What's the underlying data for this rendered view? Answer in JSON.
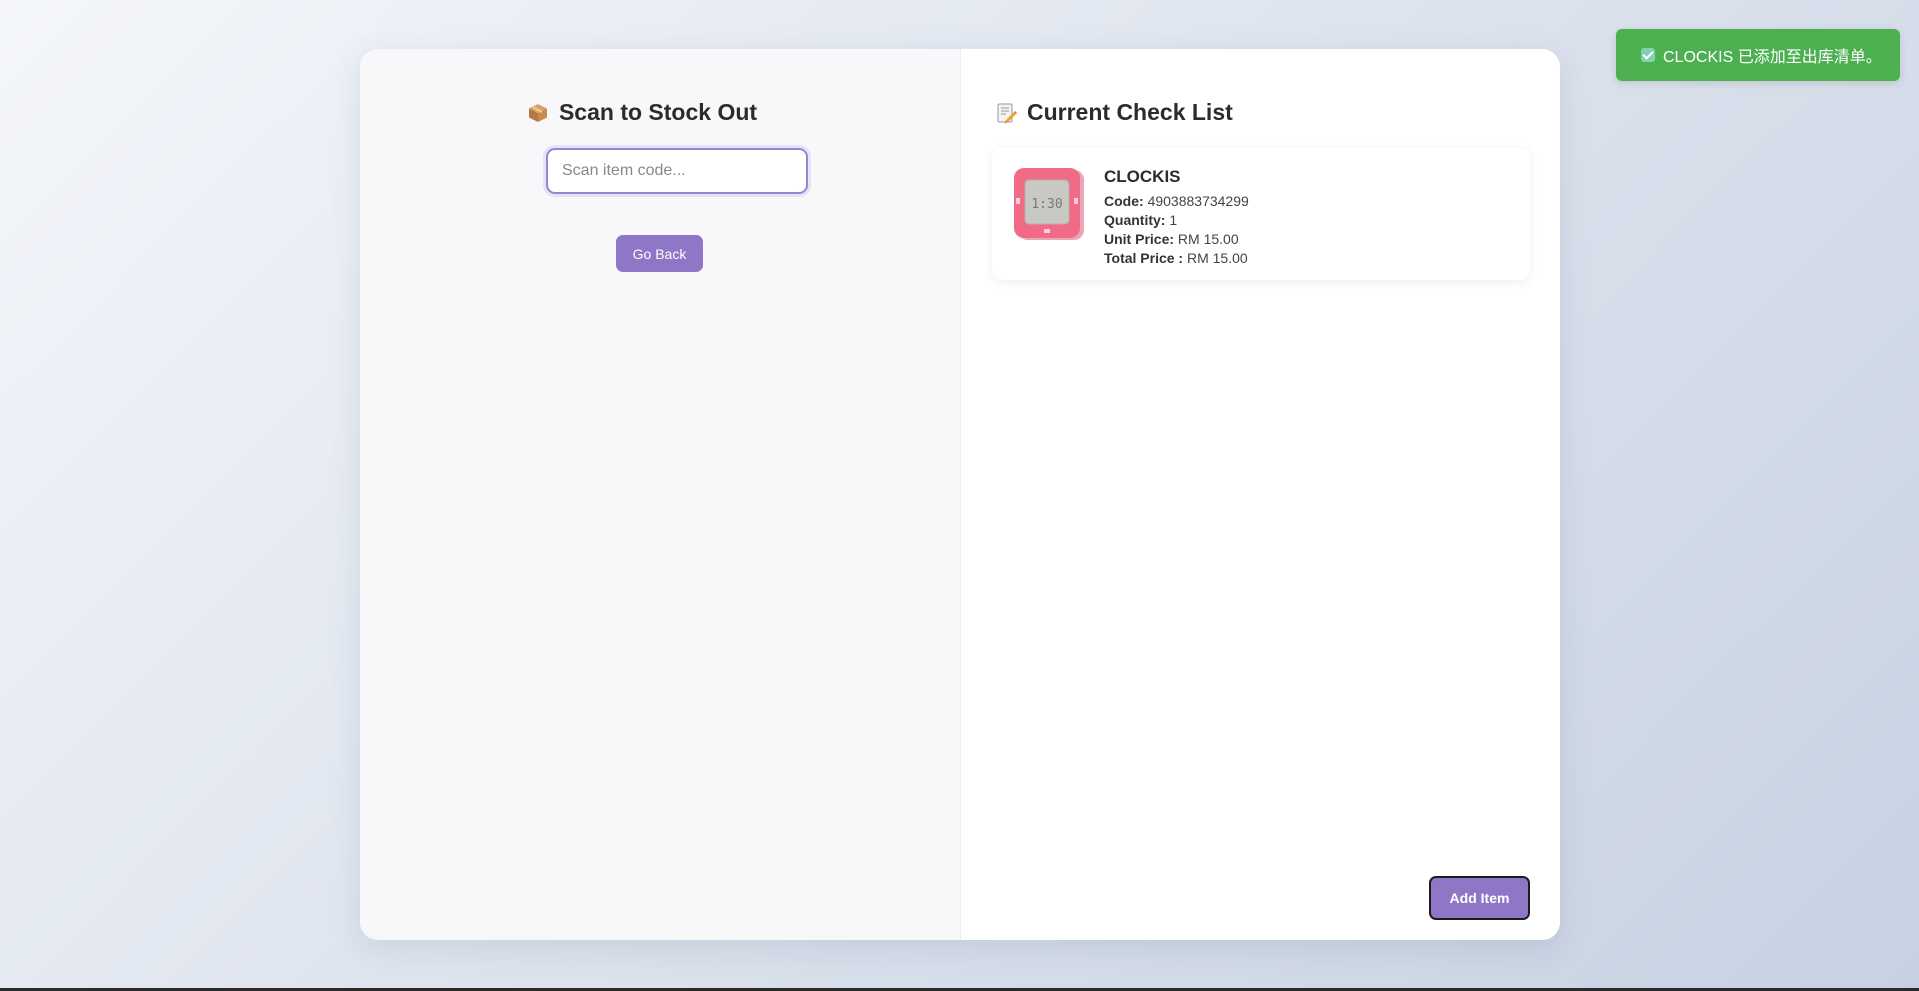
{
  "left": {
    "title": "Scan to Stock Out",
    "title_icon": "package-icon",
    "input_placeholder": "Scan item code...",
    "input_value": "",
    "go_back_label": "Go Back"
  },
  "right": {
    "title": "Current Check List",
    "title_icon": "memo-icon",
    "items": [
      {
        "name": "CLOCKIS",
        "code_label": "Code:",
        "code": "4903883734299",
        "quantity_label": "Quantity:",
        "quantity": "1",
        "unit_price_label": "Unit Price:",
        "unit_price": "RM 15.00",
        "total_price_label": "Total Price :",
        "total_price": "RM 15.00",
        "thumbnail_icon": "clock-thumbnail",
        "thumbnail_text": "1:30"
      }
    ],
    "add_item_label": "Add Item"
  },
  "toast": {
    "message": "CLOCKIS 已添加至出库清单。",
    "icon": "check-icon"
  },
  "colors": {
    "accent": "#8f76c6",
    "toast_bg": "#4caf50"
  }
}
